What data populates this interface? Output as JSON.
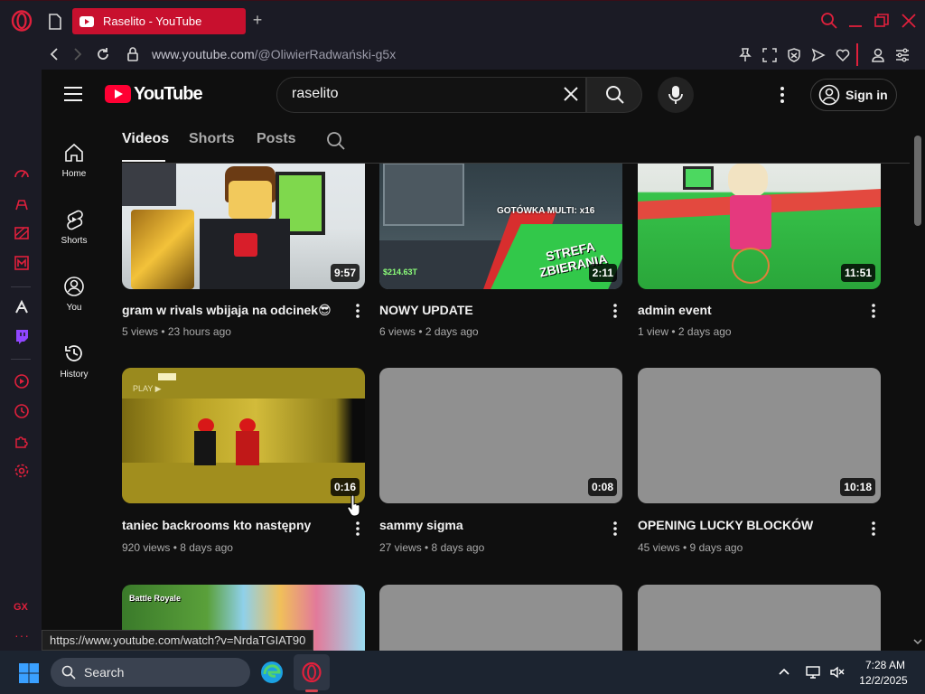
{
  "browser": {
    "tab_title": "Raselito - YouTube",
    "url_host": "www.youtube.com",
    "url_path": "/@OliwierRadwański-g5x",
    "status_url": "https://www.youtube.com/watch?v=NrdaTGIAT90",
    "sidebar_gx_label": "GX"
  },
  "header": {
    "logo_text": "YouTube",
    "search_value": "raselito",
    "signin_label": "Sign in"
  },
  "guide": [
    {
      "label": "Home"
    },
    {
      "label": "Shorts"
    },
    {
      "label": "You"
    },
    {
      "label": "History"
    }
  ],
  "channel_tabs": [
    {
      "label": "Videos"
    },
    {
      "label": "Shorts"
    },
    {
      "label": "Posts"
    }
  ],
  "videos": [
    {
      "title": "gram w rivals wbijaja na odcinek😎",
      "meta": "5 views • 23 hours ago",
      "duration": "9:57"
    },
    {
      "title": "NOWY UPDATE",
      "meta": "6 views • 2 days ago",
      "duration": "2:11",
      "thumb_text_1": "GOTÓWKA MULTI: x16",
      "thumb_text_2": "STREFA ZBIERANIA",
      "thumb_text_3": "$214.63T"
    },
    {
      "title": "admin event",
      "meta": "1 view • 2 days ago",
      "duration": "11:51"
    },
    {
      "title": "taniec backrooms kto następny",
      "meta": "920 views • 8 days ago",
      "duration": "0:16",
      "thumb_text_1": "PLAY ▶"
    },
    {
      "title": "sammy sigma",
      "meta": "27 views • 8 days ago",
      "duration": "0:08"
    },
    {
      "title": "OPENING LUCKY BLOCKÓW",
      "meta": "45 views • 9 days ago",
      "duration": "10:18"
    },
    {
      "thumb_text_1": "Battle Royale"
    }
  ],
  "taskbar": {
    "search_label": "Search",
    "time": "7:28 AM",
    "date": "12/2/2025"
  },
  "colors": {
    "opera_accent": "#c8102e",
    "youtube_red": "#ff0033",
    "background": "#0f0f0f"
  }
}
